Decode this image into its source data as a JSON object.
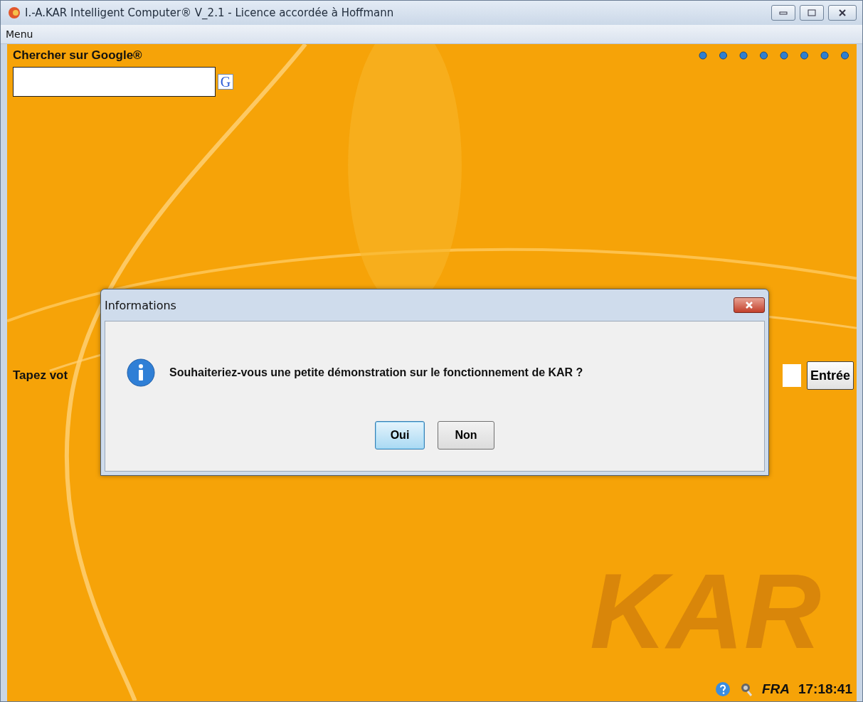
{
  "window": {
    "title": "I.-A.KAR Intelligent Computer® V_2.1 - Licence accordée à Hoffmann"
  },
  "menu_bar": {
    "items": [
      "Menu"
    ]
  },
  "google_search": {
    "label": "Chercher sur Google®",
    "button": "G"
  },
  "command_row": {
    "label": "Tapez vot",
    "button": "Entrée"
  },
  "background_logo": "KAR",
  "status_bar": {
    "language": "FRA",
    "time": "17:18:41"
  },
  "dialog": {
    "title": "Informations",
    "message": "Souhaiteriez-vous une petite démonstration sur le fonctionnement de KAR ?",
    "buttons": [
      {
        "label": "Oui",
        "default": true
      },
      {
        "label": "Non",
        "default": false
      }
    ]
  }
}
